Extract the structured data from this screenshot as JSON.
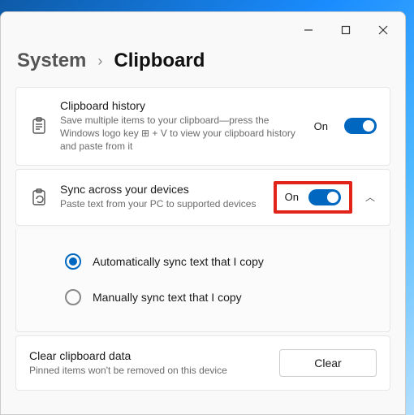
{
  "breadcrumb": {
    "section": "System",
    "page": "Clipboard",
    "separator": "›"
  },
  "history": {
    "title": "Clipboard history",
    "desc": "Save multiple items to your clipboard—press the Windows logo key ⊞ + V to view your clipboard history and paste from it",
    "state": "On"
  },
  "sync": {
    "title": "Sync across your devices",
    "desc": "Paste text from your PC to supported devices",
    "state": "On",
    "options": {
      "auto": "Automatically sync text that I copy",
      "manual": "Manually sync text that I copy"
    }
  },
  "clear": {
    "title": "Clear clipboard data",
    "desc": "Pinned items won't be removed on this device",
    "button": "Clear"
  }
}
